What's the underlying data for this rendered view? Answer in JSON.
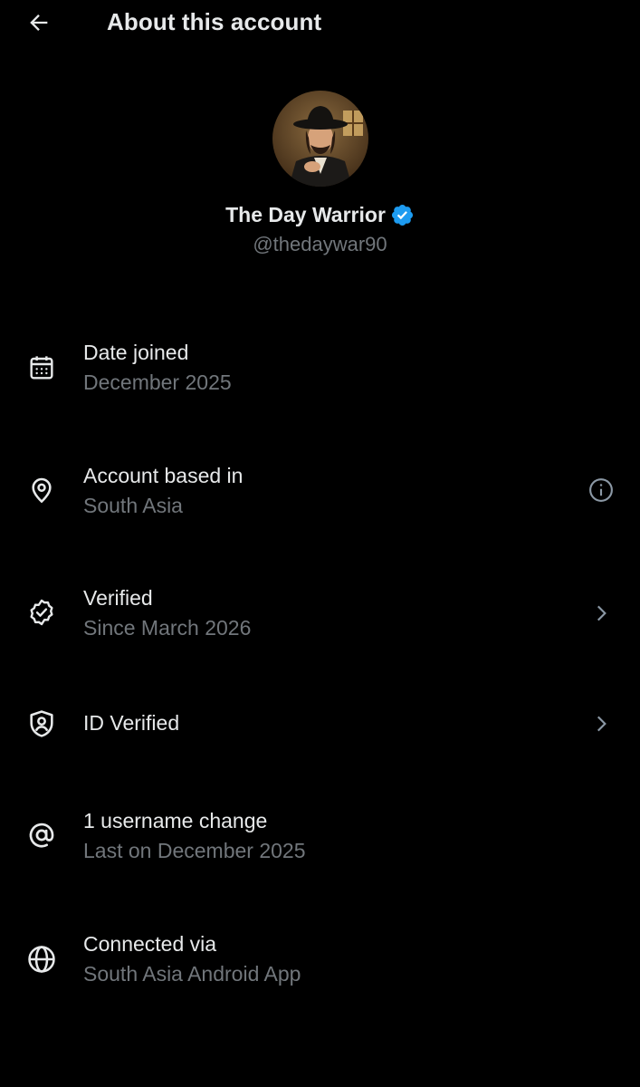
{
  "header": {
    "title": "About this account",
    "back_icon": "arrow-left-icon"
  },
  "profile": {
    "display_name": "The Day Warrior",
    "handle": "@thedaywar90",
    "verified_badge_color": "#1d9bf0"
  },
  "rows": [
    {
      "icon": "calendar-icon",
      "title": "Date joined",
      "subtitle": "December 2025",
      "action": null
    },
    {
      "icon": "location-pin-icon",
      "title": "Account based in",
      "subtitle": "South Asia",
      "action": "info-icon"
    },
    {
      "icon": "verified-check-icon",
      "title": "Verified",
      "subtitle": "Since March 2026",
      "action": "chevron-right-icon"
    },
    {
      "icon": "shield-person-icon",
      "title": "ID Verified",
      "subtitle": "",
      "action": "chevron-right-icon"
    },
    {
      "icon": "at-sign-icon",
      "title": "1 username change",
      "subtitle": "Last on December 2025",
      "action": null
    },
    {
      "icon": "globe-icon",
      "title": "Connected via",
      "subtitle": "South Asia Android App",
      "action": null
    }
  ],
  "colors": {
    "background": "#000000",
    "primary_text": "#e7e9ea",
    "secondary_text": "#71767b",
    "accent": "#1d9bf0"
  }
}
